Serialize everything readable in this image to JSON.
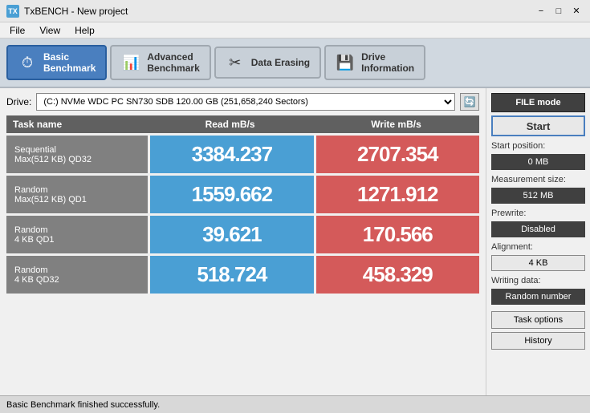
{
  "titleBar": {
    "title": "TxBENCH - New project",
    "icon": "TX",
    "controls": [
      "−",
      "□",
      "✕"
    ]
  },
  "menuBar": {
    "items": [
      "File",
      "View",
      "Help"
    ]
  },
  "toolbar": {
    "buttons": [
      {
        "id": "basic-benchmark",
        "icon": "⏱",
        "label": "Basic\nBenchmark",
        "active": true
      },
      {
        "id": "advanced-benchmark",
        "icon": "📊",
        "label": "Advanced\nBenchmark",
        "active": false
      },
      {
        "id": "data-erasing",
        "icon": "🗑",
        "label": "Data Erasing",
        "active": false
      },
      {
        "id": "drive-information",
        "icon": "💾",
        "label": "Drive\nInformation",
        "active": false
      }
    ]
  },
  "driveRow": {
    "label": "Drive:",
    "value": "(C:) NVMe WDC PC SN730 SDB  120.00 GB (251,658,240 Sectors)",
    "placeholder": "(C:) NVMe WDC PC SN730 SDB  120.00 GB (251,658,240 Sectors)"
  },
  "table": {
    "headers": [
      "Task name",
      "Read mB/s",
      "Write mB/s"
    ],
    "rows": [
      {
        "label1": "Sequential",
        "label2": "Max(512 KB) QD32",
        "read": "3384.237",
        "write": "2707.354"
      },
      {
        "label1": "Random",
        "label2": "Max(512 KB) QD1",
        "read": "1559.662",
        "write": "1271.912"
      },
      {
        "label1": "Random",
        "label2": "4 KB QD1",
        "read": "39.621",
        "write": "170.566"
      },
      {
        "label1": "Random",
        "label2": "4 KB QD32",
        "read": "518.724",
        "write": "458.329"
      }
    ]
  },
  "rightPanel": {
    "fileModeLabel": "FILE mode",
    "startLabel": "Start",
    "startPosition": {
      "label": "Start position:",
      "value": "0 MB"
    },
    "measurementSize": {
      "label": "Measurement size:",
      "value": "512 MB"
    },
    "prewrite": {
      "label": "Prewrite:",
      "value": "Disabled"
    },
    "alignment": {
      "label": "Alignment:",
      "value": "4 KB"
    },
    "writingData": {
      "label": "Writing data:",
      "value": "Random number"
    },
    "taskOptionsLabel": "Task options",
    "historyLabel": "History"
  },
  "statusBar": {
    "text": "Basic Benchmark finished successfully."
  }
}
